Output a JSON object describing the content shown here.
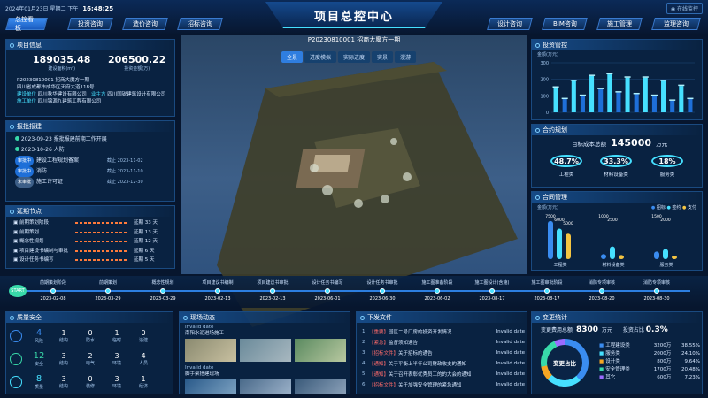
{
  "header": {
    "datetime": "2024年01月23日 星期二 下午",
    "clock": "16:48:25",
    "title": "项目总控中心",
    "right_action": "在线监控",
    "nav_left": [
      "总控看板",
      "投资咨询",
      "造价咨询",
      "招标咨询"
    ],
    "nav_right": [
      "设计咨询",
      "BIM咨询",
      "施工管理",
      "监理咨询"
    ]
  },
  "project_info": {
    "title": "项目信息",
    "area_value": "189035.48",
    "area_label": "建设面积(m²)",
    "invest_value": "206500.22",
    "invest_label": "投资金额(万)",
    "lines": [
      "P20230810001 招商大魔方一期",
      "四川省成都市成华区天府大道118号"
    ],
    "builder_label": "建设单位",
    "builder_value": "四川秋华建设有限公司",
    "owner_label": "业主方",
    "owner_value": "四川国锐建筑设计有限公司",
    "constructor_label": "施工单位",
    "constructor_value": "四川锦源九建筑工程有限公司"
  },
  "report": {
    "title": "报批报建",
    "items": [
      {
        "text": "2023-09-23 报批报建前期工作开展"
      },
      {
        "text": "2023-10-26 人防"
      }
    ],
    "rows": [
      {
        "tag": "审批中",
        "name": "建设工程规划备案",
        "date": "截止 2023-11-02"
      },
      {
        "tag": "审批中",
        "name": "消防",
        "date": "截止 2023-11-10"
      },
      {
        "tag": "未审批",
        "name": "施工许可证",
        "date": "截止 2023-12-30"
      }
    ]
  },
  "milestones": {
    "title": "延期节点",
    "rows": [
      {
        "name": "前期策划阶段",
        "delay": "延期 33 天"
      },
      {
        "name": "前期策划",
        "delay": "延期 13 天"
      },
      {
        "name": "概念性规划",
        "delay": "延期 12 天"
      },
      {
        "name": "项目建设书编制与审批",
        "delay": "延期 6 天"
      },
      {
        "name": "设计任务书编写",
        "delay": "延期 5 天"
      }
    ]
  },
  "center": {
    "project_code": "P20230810001 招商大魔方一期",
    "tabs": [
      "全景",
      "进度模拟",
      "实际进度",
      "实景",
      "漫游"
    ]
  },
  "investment": {
    "title": "投资管控",
    "unit": "金额(万元)",
    "yticks": [
      "300",
      "200",
      "100",
      "0"
    ]
  },
  "contract_plan": {
    "title": "合约规划",
    "total_label": "目标成本总额",
    "total_value": "145000",
    "total_unit": "万元",
    "items": [
      {
        "pct": "48.7%",
        "label": "工程类"
      },
      {
        "pct": "33.3%",
        "label": "材料设备类"
      },
      {
        "pct": "18%",
        "label": "服务类"
      }
    ]
  },
  "contract_mgmt": {
    "title": "合同管理",
    "unit": "金额(万元)",
    "legend": [
      "招标",
      "签约",
      "支付"
    ],
    "groups": [
      {
        "label": "工程类",
        "values": [
          "7500",
          "6000",
          "5000"
        ]
      },
      {
        "label": "材料设备类",
        "values": [
          "1000",
          "2500"
        ]
      },
      {
        "label": "服务类",
        "values": [
          "1500",
          "2000"
        ]
      }
    ]
  },
  "timeline": {
    "start": "START",
    "nodes": [
      {
        "name": "前期策划阶段",
        "date": "2023-02-08"
      },
      {
        "name": "前期策划",
        "date": "2023-03-29"
      },
      {
        "name": "概念性规划",
        "date": "2023-03-29"
      },
      {
        "name": "项目建议书编制",
        "date": "2023-02-13"
      },
      {
        "name": "项目建议书审批",
        "date": "2023-02-13"
      },
      {
        "name": "设计任务书编写",
        "date": "2023-06-01"
      },
      {
        "name": "设计任务书审批",
        "date": "2023-06-30"
      },
      {
        "name": "施工图准备阶段",
        "date": "2023-06-02"
      },
      {
        "name": "施工图设计(含施)",
        "date": "2023-08-17"
      },
      {
        "name": "施工图审批阶段",
        "date": "2023-08-17"
      },
      {
        "name": "消防专项审核",
        "date": "2023-08-20"
      },
      {
        "name": "消防专项审核",
        "date": "2023-08-30"
      }
    ]
  },
  "quality": {
    "title": "质量安全",
    "rows": [
      {
        "big": "4",
        "big_label": "风险",
        "cells": [
          [
            "1",
            "结构"
          ],
          [
            "0",
            "防水"
          ],
          [
            "1",
            "临时"
          ],
          [
            "0",
            "违建"
          ]
        ]
      },
      {
        "big": "12",
        "big_label": "安全",
        "cells": [
          [
            "3",
            "结构"
          ],
          [
            "2",
            "电气"
          ],
          [
            "3",
            "环境"
          ],
          [
            "4",
            "人员"
          ]
        ]
      },
      {
        "big": "8",
        "big_label": "质量",
        "cells": [
          [
            "3",
            "结构"
          ],
          [
            "0",
            "装修"
          ],
          [
            "3",
            "环境"
          ],
          [
            "1",
            "经济"
          ]
        ]
      }
    ]
  },
  "site": {
    "title": "现场动态",
    "items": [
      {
        "status": "Invalid date",
        "caption": "南阳水泥进场施工"
      },
      {
        "status": "Invalid date",
        "caption": "脚手架搭建现场"
      }
    ]
  },
  "documents": {
    "title": "下发文件",
    "items": [
      {
        "n": "1",
        "tag": "【重要】",
        "text": "园区二号厂房的投资开发情况",
        "date": "Invalid date"
      },
      {
        "n": "2",
        "tag": "【紧急】",
        "text": "监督须知通告",
        "date": "Invalid date"
      },
      {
        "n": "3",
        "tag": "【招标文件】",
        "text": "关于招标的通告",
        "date": "Invalid date"
      },
      {
        "n": "4",
        "tag": "【通知】",
        "text": "关于平衡上半年公司财政收支的通知",
        "date": "Invalid date"
      },
      {
        "n": "5",
        "tag": "【通知】",
        "text": "关于召开表彰优秀员工的的大会的通知",
        "date": "Invalid date"
      },
      {
        "n": "6",
        "tag": "【招标文件】",
        "text": "关于加强安全管理的紧急通知",
        "date": "Invalid date"
      }
    ]
  },
  "changes": {
    "title": "变更统计",
    "total_label": "变更费用总额",
    "total_value": "8300",
    "total_unit": "万元",
    "ratio_label": "投资占比",
    "ratio_value": "0.3%",
    "center": "变更占比",
    "rows": [
      {
        "name": "工程建设类",
        "amt": "3200万",
        "pct": "38.55%",
        "color": "#3a8cf0"
      },
      {
        "name": "服务类",
        "amt": "2000万",
        "pct": "24.10%",
        "color": "#46e0ff"
      },
      {
        "name": "设计类",
        "amt": "800万",
        "pct": "9.64%",
        "color": "#f5a623"
      },
      {
        "name": "安全管理类",
        "amt": "1700万",
        "pct": "20.48%",
        "color": "#38d9a9"
      },
      {
        "name": "其它",
        "amt": "600万",
        "pct": "7.23%",
        "color": "#9b6bff"
      }
    ]
  },
  "chart_data": [
    {
      "type": "bar",
      "title": "投资管控",
      "ylabel": "金额(万元)",
      "ylim": [
        0,
        300
      ],
      "series": [
        {
          "values": [
            150,
            80,
            190,
            100,
            220,
            140,
            230,
            120,
            210,
            110,
            210,
            100,
            190,
            70,
            160,
            80
          ]
        }
      ]
    },
    {
      "type": "bar",
      "title": "合同管理",
      "ylabel": "金额(万元)",
      "categories": [
        "工程类",
        "材料设备类",
        "服务类"
      ],
      "series": [
        {
          "name": "招标",
          "values": [
            7500,
            1000,
            1500
          ]
        },
        {
          "name": "签约",
          "values": [
            6000,
            2500,
            2000
          ]
        },
        {
          "name": "支付",
          "values": [
            5000,
            800,
            700
          ]
        }
      ]
    }
  ]
}
